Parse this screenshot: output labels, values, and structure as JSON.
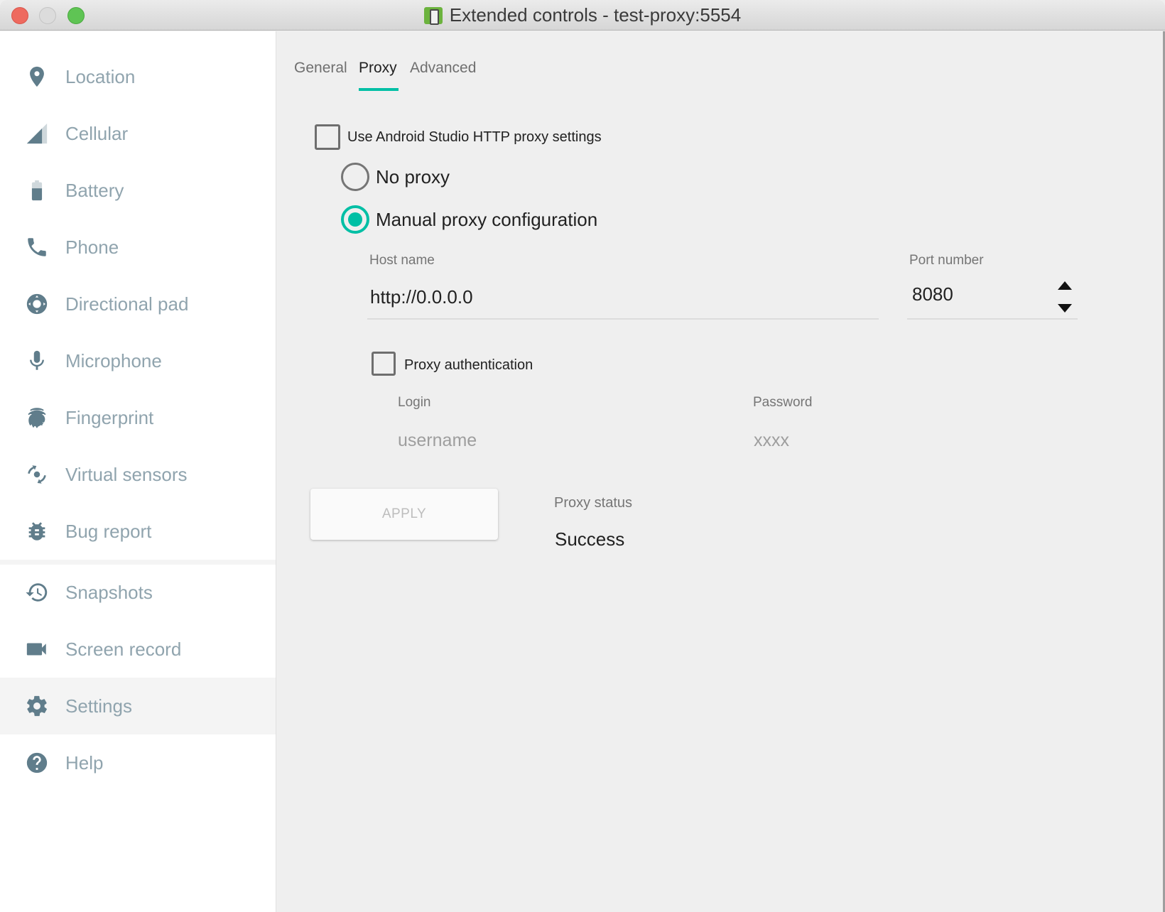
{
  "window": {
    "title": "Extended controls - test-proxy:5554",
    "app_icon": "emulator-phone-icon"
  },
  "sidebar": {
    "items": [
      {
        "label": "Location",
        "icon": "location-pin-icon"
      },
      {
        "label": "Cellular",
        "icon": "cellular-signal-icon"
      },
      {
        "label": "Battery",
        "icon": "battery-icon"
      },
      {
        "label": "Phone",
        "icon": "phone-icon"
      },
      {
        "label": "Directional pad",
        "icon": "dpad-icon"
      },
      {
        "label": "Microphone",
        "icon": "microphone-icon"
      },
      {
        "label": "Fingerprint",
        "icon": "fingerprint-icon"
      },
      {
        "label": "Virtual sensors",
        "icon": "virtual-sensors-icon"
      },
      {
        "label": "Bug report",
        "icon": "bug-icon"
      },
      {
        "label": "Snapshots",
        "icon": "history-icon"
      },
      {
        "label": "Screen record",
        "icon": "videocam-icon"
      },
      {
        "label": "Settings",
        "icon": "gear-icon",
        "active": true
      },
      {
        "label": "Help",
        "icon": "help-icon"
      }
    ]
  },
  "tabs": [
    {
      "label": "General"
    },
    {
      "label": "Proxy",
      "active": true
    },
    {
      "label": "Advanced"
    }
  ],
  "proxy": {
    "use_studio_label": "Use Android Studio HTTP proxy settings",
    "use_studio_checked": false,
    "no_proxy_label": "No proxy",
    "manual_label": "Manual proxy configuration",
    "selected_mode": "manual",
    "host_label": "Host name",
    "host_value": "http://0.0.0.0",
    "port_label": "Port number",
    "port_value": "8080",
    "auth_label": "Proxy authentication",
    "auth_checked": false,
    "login_label": "Login",
    "login_placeholder": "username",
    "password_label": "Password",
    "password_placeholder": "xxxx",
    "apply_label": "APPLY",
    "status_label": "Proxy status",
    "status_value": "Success"
  },
  "colors": {
    "accent": "#00bfa5",
    "sidebar_icon": "#607d8b",
    "sidebar_text": "#90a4ae"
  }
}
